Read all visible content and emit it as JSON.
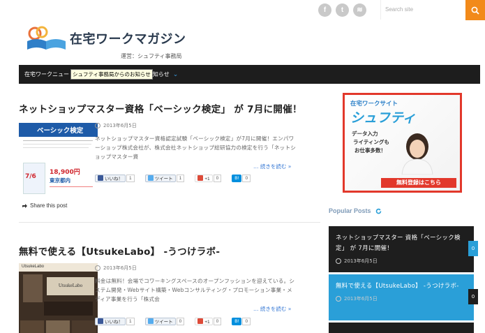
{
  "header": {
    "social": [
      {
        "icon": "facebook-icon",
        "glyph": "f"
      },
      {
        "icon": "twitter-icon",
        "glyph": "t"
      },
      {
        "icon": "rss-icon",
        "glyph": "≋"
      }
    ],
    "search_placeholder": "Search site",
    "logo_title": "在宅ワークマガジン",
    "logo_sub": "運営：シュフティ事務局",
    "accent": "#f28a1a"
  },
  "nav": {
    "item": "在宅ワークニュー",
    "tooltip": "シュフティ事務局からのお知らせ",
    "item_tail": "知らせ"
  },
  "articles": [
    {
      "title": "ネットショップマスター資格「ベーシック検定」 が 7月に開催！",
      "date": "2013年6月5日",
      "excerpt": "ネットショップマスター資格認定試験「ベーシック検定」が7月に開催！エンパワーショップ株式会社が、株式会社ネットショップ総研協力の検定を行う「ネットショップマスター資",
      "more": "… 続きを読む »",
      "share": {
        "like": "いいね！",
        "like_count": "1",
        "tweet": "ツイート",
        "tweet_count": "1",
        "gplus_count": "0",
        "hatena_count": "0"
      },
      "share_post": "Share this post",
      "thumb": {
        "head": "ベーシック検定",
        "date": "7/6",
        "price": "18,900円",
        "place": "東京都内"
      }
    },
    {
      "title": "無料で使える【UtsukeLabo】 -うつけラボ-",
      "date": "2013年6月5日",
      "excerpt": "料金は無料！会場でコワーキングスペースのオープンフッションを迎えている。システム開発・Webサイト構築・Webコンサルティング・プロモーション事業・メディア事業を行う「株式会",
      "more": "… 続きを読む »",
      "share": {
        "like": "いいね！",
        "like_count": "1",
        "tweet": "ツイート",
        "tweet_count": "0",
        "gplus_count": "0",
        "hatena_count": "0"
      },
      "thumb": {
        "brand": "UtsukeLabo"
      }
    }
  ],
  "sidebar": {
    "banner": {
      "top": "在宅ワークサイト",
      "brand": "シュフティ",
      "tag1": "データ入力",
      "tag2": "ライティングも",
      "tag3": "お仕事多数！",
      "cta": "無料登録はこちら"
    },
    "popular_title": "Popular Posts",
    "popular": [
      {
        "title": "ネットショップマスター 資格「ベーシック検定」 が 7月に開催！",
        "date": "2013年6月5日",
        "count": "0",
        "bg": "#1e1e1e"
      },
      {
        "title": "無料で使える【UtsukeLabo】 -うつけラボ-",
        "date": "2013年6月5日",
        "count": "0",
        "bg": "#2a9fd8"
      }
    ]
  }
}
